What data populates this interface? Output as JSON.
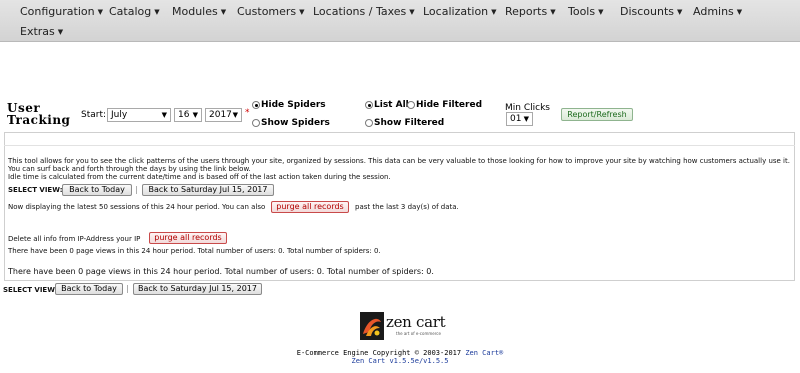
{
  "nav": {
    "row1": [
      "Configuration",
      "Catalog",
      "Modules",
      "Customers",
      "Locations / Taxes",
      "Localization",
      "Reports",
      "Tools",
      "Discounts",
      "Admins"
    ],
    "row2": [
      "Extras"
    ]
  },
  "header": {
    "title_line1": "User",
    "title_line2": "Tracking",
    "start_label": "Start:",
    "month": "July",
    "day": "16",
    "year": "2017",
    "required_mark": "*",
    "hide_spiders": "Hide Spiders",
    "show_spiders": "Show Spiders",
    "list_all": "List All",
    "hide_filtered": "Hide Filtered",
    "show_filtered": "Show Filtered",
    "min_clicks_label": "Min Clicks",
    "min_clicks_value": "01",
    "report_button": "Report/Refresh"
  },
  "content": {
    "intro1": "This tool allows for you to see the click patterns of the users through your site, organized by sessions. This data can be very valuable to those looking for how to improve your site by watching how customers actually use it.",
    "intro2": "You can surf back and forth through the days by using the link below.",
    "intro3": "Idle time is calculated from the current date/time and is based off of the last action taken during the session.",
    "select_view_label": "SELECT VIEW:",
    "back_today": "Back to Today",
    "separator": "|",
    "back_date": "Back to Saturday Jul 15, 2017",
    "displaying_pre": "Now displaying the latest 50 sessions of this 24 hour period. You can also",
    "purge_all": "purge all records",
    "displaying_post": "past the last 3 day(s) of data.",
    "delete_ip_label": "Delete all info from IP-Address your IP",
    "purge_all_2": "purge all records",
    "stats_small": "There have been 0 page views in this 24 hour period. Total number of users: 0. Total number of spiders: 0.",
    "stats_big": "There have been 0 page views in this 24 hour period. Total number of users: 0. Total number of spiders: 0."
  },
  "bottom": {
    "select_view_label": "SELECT VIEW:",
    "back_today": "Back to Today",
    "separator": "|",
    "back_date": "Back to Saturday Jul 15, 2017"
  },
  "footer": {
    "logo_text": "zen cart",
    "logo_tagline": "the art of e-commerce",
    "copyright_pre": "E-Commerce Engine Copyright © 2003-2017",
    "copyright_link": "Zen Cart®",
    "version": "Zen Cart v1.5.5e/v1.5.5"
  },
  "colors": {
    "nav_bg": "#d9d9d9",
    "link": "#1a3a9a",
    "purge_red": "#b00000",
    "report_green": "#1e6b1e",
    "required_red": "#d00000"
  }
}
